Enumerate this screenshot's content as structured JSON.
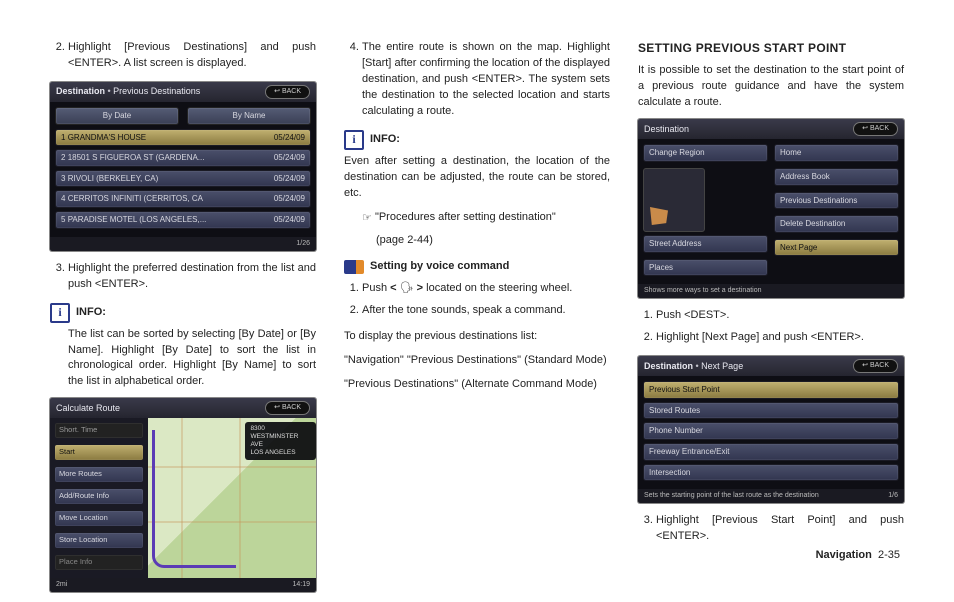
{
  "footer": {
    "section": "Navigation",
    "page": "2-35"
  },
  "col1": {
    "step2": "Highlight [Previous Destinations] and push <ENTER>. A list screen is displayed.",
    "step3": "Highlight the preferred destination from the list and push <ENTER>.",
    "info_label": "INFO:",
    "info_body": "The list can be sorted by selecting [By Date] or [By Name]. Highlight [By Date] to sort the list in chronological order. Highlight [By Name] to sort the list in alphabetical order."
  },
  "scr1": {
    "title": "Destination",
    "subtitle": "Previous Destinations",
    "back": "BACK",
    "tabs": [
      "By Date",
      "By Name"
    ],
    "pager": "1/26",
    "rows": [
      {
        "n": "1",
        "name": "GRANDMA'S HOUSE",
        "date": "05/24/09"
      },
      {
        "n": "2",
        "name": "18501 S FIGUEROA ST (GARDENA...",
        "date": "05/24/09"
      },
      {
        "n": "3",
        "name": "RIVOLI (BERKELEY, CA)",
        "date": "05/24/09"
      },
      {
        "n": "4",
        "name": "CERRITOS INFINITI (CERRITOS, CA",
        "date": "05/24/09"
      },
      {
        "n": "5",
        "name": "PARADISE MOTEL (LOS ANGELES,...",
        "date": "05/24/09"
      }
    ]
  },
  "scr2": {
    "title": "Calculate Route",
    "back": "BACK",
    "side": [
      "Short. Time",
      "Start",
      "More Routes",
      "Add/Route Info",
      "Move Location",
      "Store Location",
      "Place Info"
    ],
    "dest_line1": "8300 WESTMINSTER AVE",
    "dest_line2": "LOS ANGELES",
    "foot_left": "2mi",
    "foot_right": "14:19"
  },
  "col2": {
    "step4": "The entire route is shown on the map. Highlight [Start] after confirming the location of the displayed destination, and push <ENTER>. The system sets the destination to the selected location and starts calculating a route.",
    "info_label": "INFO:",
    "info_body": "Even after setting a destination, the location of the destination can be adjusted, the route can be stored, etc.",
    "xref": "\"Procedures after setting destination\"",
    "xref_page": "(page 2-44)",
    "voice_title": "Setting by voice command",
    "voice_step1": "Push <  >  located on the steering wheel.",
    "voice_step2": "After the tone sounds, speak a command.",
    "voice_lead": "To display the previous destinations list:",
    "voice_cmd1": "\"Navigation\" \"Previous Destinations\" (Standard Mode)",
    "voice_cmd2": "\"Previous Destinations\" (Alternate Command Mode)"
  },
  "col3": {
    "heading": "SETTING PREVIOUS START POINT",
    "lead": "It is possible to set the destination to the start point of a previous route guidance and have the system calculate a route.",
    "step1": "Push <DEST>.",
    "step2": "Highlight [Next Page] and push <ENTER>.",
    "step3": "Highlight [Previous Start Point] and push <ENTER>."
  },
  "scr3": {
    "title": "Destination",
    "back": "BACK",
    "left": [
      "Change Region",
      "",
      "Street Address",
      "Places"
    ],
    "right": [
      "Home",
      "Address Book",
      "Previous Destinations",
      "Delete Destination",
      "Next Page"
    ],
    "foot": "Shows more ways to set a destination"
  },
  "scr4": {
    "title": "Destination",
    "subtitle": "Next Page",
    "back": "BACK",
    "rows": [
      "Previous Start Point",
      "Stored Routes",
      "Phone Number",
      "Freeway Entrance/Exit",
      "Intersection"
    ],
    "pager": "1/6",
    "foot": "Sets the starting point of the last route as the destination"
  }
}
